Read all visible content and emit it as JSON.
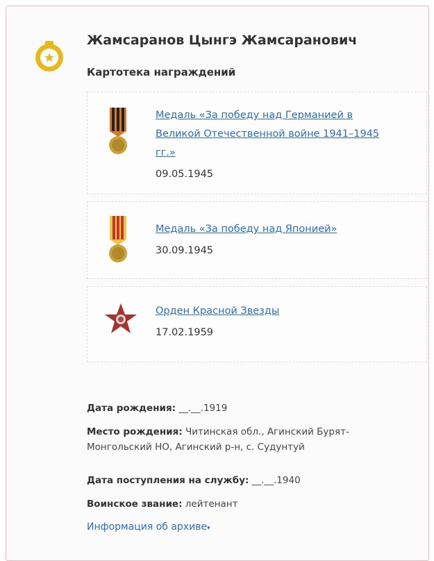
{
  "person": {
    "name": "Жамсаранов Цынгэ Жамсаранович"
  },
  "section_title": "Картотека награждений",
  "awards": [
    {
      "title": "Медаль «За победу над Германией в Великой Отечественной войне 1941–1945 гг.»",
      "date": "09.05.1945",
      "icon": "medal-victory-germany-icon"
    },
    {
      "title": "Медаль «За победу над Японией»",
      "date": "30.09.1945",
      "icon": "medal-victory-japan-icon"
    },
    {
      "title": "Орден Красной Звезды",
      "date": "17.02.1959",
      "icon": "order-red-star-icon"
    }
  ],
  "info": {
    "birth_date_label": "Дата рождения:",
    "birth_date_value": "__.__.1919",
    "birth_place_label": "Место рождения:",
    "birth_place_value": "Читинская обл., Агинский Бурят-Монгольский НО, Агинский р-н, с. Судунтуй",
    "service_start_label": "Дата поступления на службу:",
    "service_start_value": "__.__.1940",
    "rank_label": "Воинское звание:",
    "rank_value": "лейтенант"
  },
  "archive_link": "Информация об архиве",
  "colors": {
    "link": "#2a6fb8",
    "badge": "#e8b81a",
    "card_border": "#f0b7b7"
  }
}
